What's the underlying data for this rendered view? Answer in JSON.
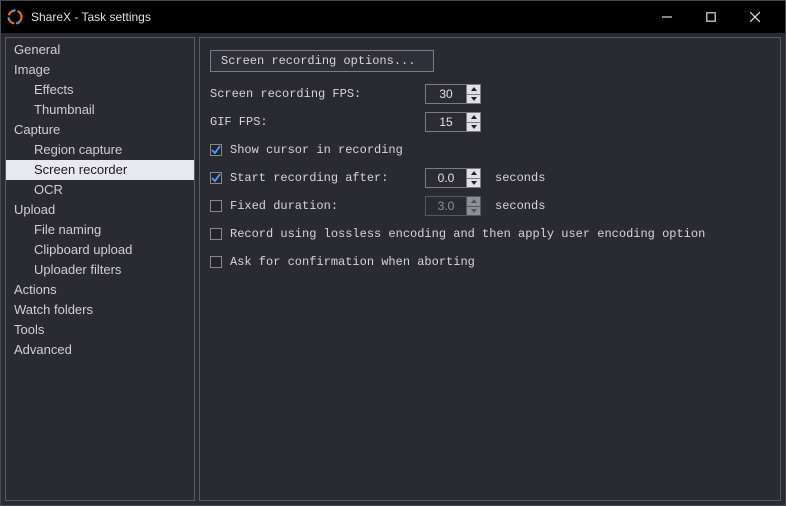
{
  "window": {
    "title": "ShareX - Task settings"
  },
  "sidebar": {
    "items": [
      {
        "label": "General",
        "level": 0,
        "selected": false
      },
      {
        "label": "Image",
        "level": 0,
        "selected": false
      },
      {
        "label": "Effects",
        "level": 1,
        "selected": false
      },
      {
        "label": "Thumbnail",
        "level": 1,
        "selected": false
      },
      {
        "label": "Capture",
        "level": 0,
        "selected": false
      },
      {
        "label": "Region capture",
        "level": 1,
        "selected": false
      },
      {
        "label": "Screen recorder",
        "level": 1,
        "selected": true
      },
      {
        "label": "OCR",
        "level": 1,
        "selected": false
      },
      {
        "label": "Upload",
        "level": 0,
        "selected": false
      },
      {
        "label": "File naming",
        "level": 1,
        "selected": false
      },
      {
        "label": "Clipboard upload",
        "level": 1,
        "selected": false
      },
      {
        "label": "Uploader filters",
        "level": 1,
        "selected": false
      },
      {
        "label": "Actions",
        "level": 0,
        "selected": false
      },
      {
        "label": "Watch folders",
        "level": 0,
        "selected": false
      },
      {
        "label": "Tools",
        "level": 0,
        "selected": false
      },
      {
        "label": "Advanced",
        "level": 0,
        "selected": false
      }
    ]
  },
  "content": {
    "options_button": "Screen recording options...",
    "fps_label": "Screen recording FPS:",
    "fps_value": "30",
    "gif_fps_label": "GIF FPS:",
    "gif_fps_value": "15",
    "show_cursor": {
      "label": "Show cursor in recording",
      "checked": true
    },
    "start_after": {
      "label": "Start recording after:",
      "checked": true,
      "value": "0.0",
      "suffix": "seconds"
    },
    "fixed_duration": {
      "label": "Fixed duration:",
      "checked": false,
      "value": "3.0",
      "suffix": "seconds"
    },
    "lossless": {
      "label": "Record using lossless encoding and then apply user encoding option",
      "checked": false
    },
    "confirm_abort": {
      "label": "Ask for confirmation when aborting",
      "checked": false
    }
  }
}
